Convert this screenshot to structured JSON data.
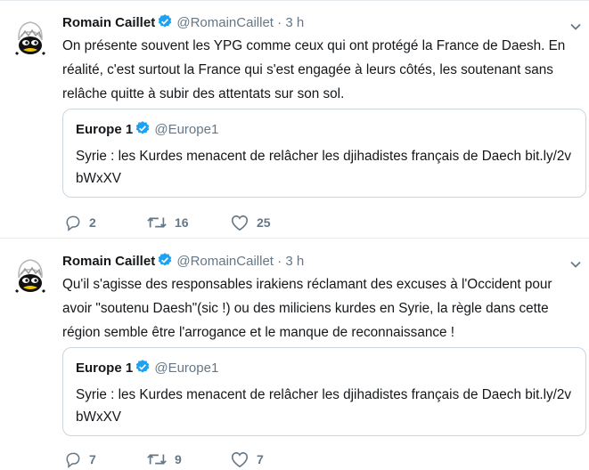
{
  "tweets": [
    {
      "author_name": "Romain Caillet",
      "handle": "@RomainCaillet",
      "dot": "·",
      "time": "3 h",
      "text": "On présente souvent les YPG comme ceux qui ont protégé la France de Daesh. En réalité, c'est surtout la France qui s'est engagée à leurs côtés, les soutenant sans relâche quitte à subir des attentats sur son sol.",
      "quote": {
        "name": "Europe 1",
        "handle": "@Europe1",
        "text": "Syrie : les Kurdes menacent de relâcher les djihadistes français de Daech bit.ly/2vbWxXV"
      },
      "replies": "2",
      "retweets": "16",
      "likes": "25"
    },
    {
      "author_name": "Romain Caillet",
      "handle": "@RomainCaillet",
      "dot": "·",
      "time": "3 h",
      "text": "Qu'il s'agisse des responsables irakiens réclamant des excuses à l'Occident pour avoir \"soutenu Daesh\"(sic !) ou des miliciens kurdes en Syrie, la règle dans cette région semble être l'arrogance et le manque de reconnaissance !",
      "quote": {
        "name": "Europe 1",
        "handle": "@Europe1",
        "text": "Syrie : les Kurdes menacent de relâcher les djihadistes français de Daech bit.ly/2vbWxXV"
      },
      "replies": "7",
      "retweets": "9",
      "likes": "7"
    }
  ],
  "icons": {
    "verified": "verified-badge-icon",
    "caret": "chevron-down-icon",
    "reply": "reply-icon",
    "retweet": "retweet-icon",
    "like": "heart-icon",
    "avatar": "calimero-avatar"
  },
  "colors": {
    "verified_blue": "#1da1f2",
    "secondary_text": "#657786",
    "border": "#ccd6dd"
  }
}
